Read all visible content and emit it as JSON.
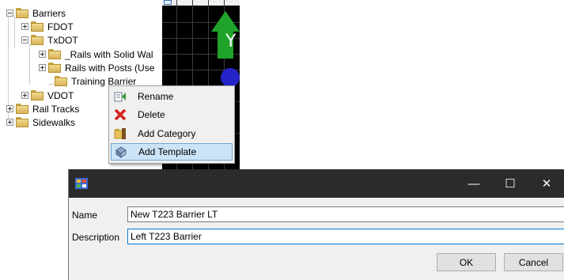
{
  "tree": {
    "items": [
      {
        "label": "Barriers",
        "toggle": "minus"
      },
      {
        "label": "FDOT",
        "toggle": "plus"
      },
      {
        "label": "TxDOT",
        "toggle": "minus"
      },
      {
        "label": "_Rails with Solid Wal",
        "toggle": "plus"
      },
      {
        "label": "Rails with Posts (Use",
        "toggle": "plus"
      },
      {
        "label": "Training Barrier",
        "toggle": "none"
      },
      {
        "label": "VDOT",
        "toggle": "plus"
      },
      {
        "label": "Rail Tracks",
        "toggle": "plus"
      },
      {
        "label": "Sidewalks",
        "toggle": "plus"
      }
    ]
  },
  "viewport": {
    "axis_label": "Y",
    "arrow_color": "#1fa32a",
    "node_color": "#2323c8"
  },
  "context_menu": {
    "items": [
      {
        "label": "Rename",
        "icon": "rename-icon"
      },
      {
        "label": "Delete",
        "icon": "delete-x-icon"
      },
      {
        "label": "Add Category",
        "icon": "add-category-icon"
      },
      {
        "label": "Add Template",
        "icon": "add-template-icon",
        "highlighted": true
      }
    ]
  },
  "dialog": {
    "title": "",
    "icon": "app-icon",
    "minimize": "—",
    "maximize": "☐",
    "close": "✕",
    "name_label": "Name",
    "name_value": "New T223 Barrier LT",
    "description_label": "Description",
    "description_value": "Left T223 Barrier",
    "ok_label": "OK",
    "cancel_label": "Cancel"
  }
}
